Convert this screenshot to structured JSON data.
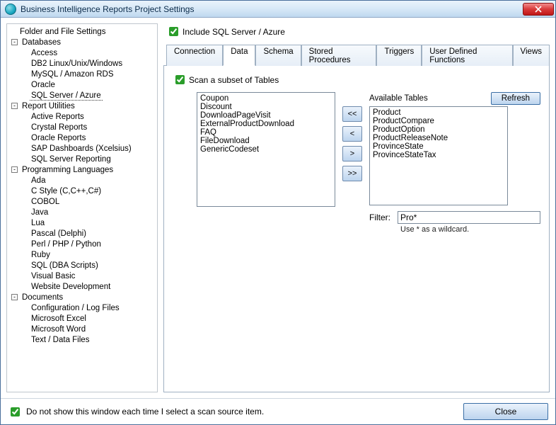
{
  "window": {
    "title": "Business Intelligence Reports Project Settings"
  },
  "tree": {
    "root": [
      {
        "label": "Folder and File Settings"
      },
      {
        "label": "Databases",
        "children": [
          "Access",
          "DB2 Linux/Unix/Windows",
          "MySQL / Amazon RDS",
          "Oracle",
          "SQL Server / Azure"
        ],
        "selectedChild": "SQL Server / Azure"
      },
      {
        "label": "Report Utilities",
        "children": [
          "Active Reports",
          "Crystal Reports",
          "Oracle Reports",
          "SAP Dashboards (Xcelsius)",
          "SQL Server Reporting"
        ]
      },
      {
        "label": "Programming Languages",
        "children": [
          "Ada",
          "C Style (C,C++,C#)",
          "COBOL",
          "Java",
          "Lua",
          "Pascal (Delphi)",
          "Perl / PHP / Python",
          "Ruby",
          "SQL (DBA Scripts)",
          "Visual Basic",
          "Website Development"
        ]
      },
      {
        "label": "Documents",
        "children": [
          "Configuration / Log Files",
          "Microsoft Excel",
          "Microsoft Word",
          "Text / Data Files"
        ]
      }
    ]
  },
  "include": {
    "label": "Include SQL Server / Azure",
    "checked": true
  },
  "tabs": {
    "items": [
      "Connection",
      "Data",
      "Schema",
      "Stored Procedures",
      "Triggers",
      "User Defined Functions",
      "Views"
    ],
    "active": "Data"
  },
  "dataTab": {
    "scanSubset": {
      "label": "Scan a subset of Tables",
      "checked": true
    },
    "leftList": [
      "Coupon",
      "Discount",
      "DownloadPageVisit",
      "ExternalProductDownload",
      "FAQ",
      "FileDownload",
      "GenericCodeset"
    ],
    "availableLabel": "Available Tables",
    "refreshLabel": "Refresh",
    "rightList": [
      "Product",
      "ProductCompare",
      "ProductOption",
      "ProductReleaseNote",
      "ProvinceState",
      "ProvinceStateTax"
    ],
    "moveBtns": {
      "allLeft": "<<",
      "left": "<",
      "right": ">",
      "allRight": ">>"
    },
    "filter": {
      "label": "Filter:",
      "value": "Pro*",
      "hint": "Use * as a wildcard."
    }
  },
  "footer": {
    "dontShow": {
      "label": "Do not show this window each time I select a scan source item.",
      "checked": true
    },
    "close": "Close"
  }
}
